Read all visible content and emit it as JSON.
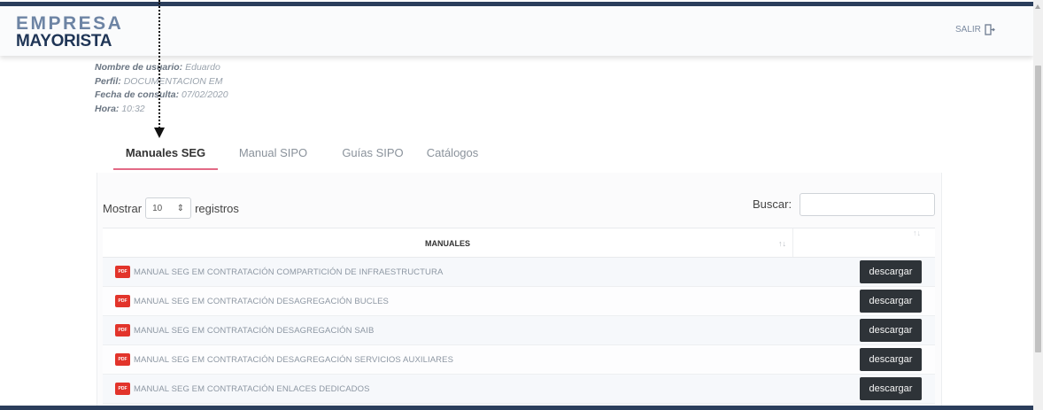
{
  "header": {
    "logo_line1": "EMPRESA",
    "logo_line2": "MAYORISTA",
    "logout_label": "SALIR",
    "logout_icon": "logout-door-icon"
  },
  "user_info": {
    "name_label": "Nombre de usuario:",
    "name_value": "Eduardo",
    "profile_label": "Perfil:",
    "profile_value": "DOCUMENTACION EM",
    "date_label": "Fecha de consulta:",
    "date_value": "07/02/2020",
    "time_label": "Hora:",
    "time_value": "10:32"
  },
  "tabs": [
    {
      "label": "Manuales SEG",
      "active": true
    },
    {
      "label": "Manual SIPO",
      "active": false
    },
    {
      "label": "Guías SIPO",
      "active": false
    },
    {
      "label": "Catálogos",
      "active": false
    }
  ],
  "table_controls": {
    "show_label": "Mostrar",
    "page_size": "10",
    "records_label": "registros",
    "search_label": "Buscar:",
    "search_value": ""
  },
  "table": {
    "column_header": "MANUALES",
    "sort_glyph": "↑↓",
    "rows": [
      {
        "icon": "pdf-icon",
        "label": "MANUAL SEG EM CONTRATACIÓN COMPARTICIÓN DE INFRAESTRUCTURA",
        "action": "descargar"
      },
      {
        "icon": "pdf-icon",
        "label": "MANUAL SEG EM CONTRATACIÓN DESAGREGACIÓN BUCLES",
        "action": "descargar"
      },
      {
        "icon": "pdf-icon",
        "label": "MANUAL SEG EM CONTRATACIÓN DESAGREGACIÓN SAIB",
        "action": "descargar"
      },
      {
        "icon": "pdf-icon",
        "label": "MANUAL SEG EM CONTRATACIÓN DESAGREGACIÓN SERVICIOS AUXILIARES",
        "action": "descargar"
      },
      {
        "icon": "pdf-icon",
        "label": "MANUAL SEG EM CONTRATACIÓN ENLACES DEDICADOS",
        "action": "descargar"
      }
    ]
  },
  "colors": {
    "brand_dark": "#1f3556",
    "brand_light": "#6d84a4",
    "active_tab_underline": "#e36a86",
    "button_bg": "#2e3338",
    "pdf_red": "#e2342b"
  }
}
